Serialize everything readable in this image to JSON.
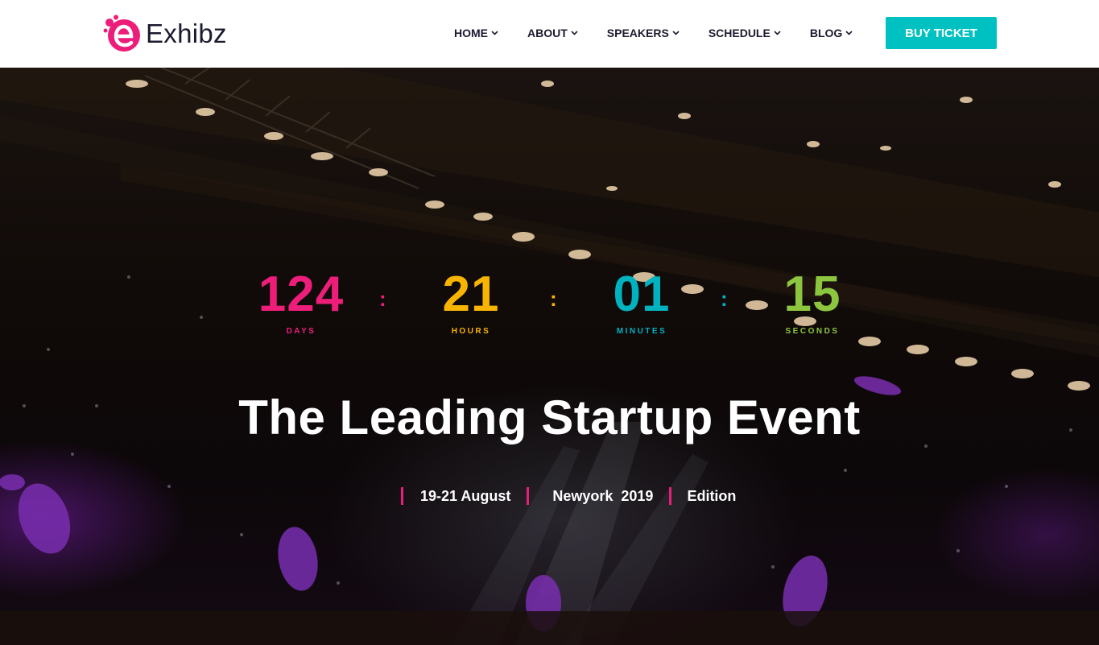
{
  "brand": {
    "name": "Exhibz",
    "logo_letter": "e"
  },
  "nav": {
    "items": [
      {
        "label": "HOME"
      },
      {
        "label": "ABOUT"
      },
      {
        "label": "SPEAKERS"
      },
      {
        "label": "SCHEDULE"
      },
      {
        "label": "BLOG"
      }
    ],
    "cta_label": "BUY TICKET"
  },
  "countdown": {
    "separator": ":",
    "units": [
      {
        "value": "124",
        "label": "DAYS",
        "color": "#ec1e79"
      },
      {
        "value": "21",
        "label": "HOURS",
        "color": "#f7b400"
      },
      {
        "value": "01",
        "label": "MINUTES",
        "color": "#00b2c0"
      },
      {
        "value": "15",
        "label": "SECONDS",
        "color": "#8cc63f"
      }
    ]
  },
  "hero": {
    "title": "The Leading Startup Event",
    "meta": [
      "19-21 August",
      "Newyork  2019",
      "Edition"
    ]
  },
  "colors": {
    "accent_cyan": "#00c1c1",
    "accent_pink": "#e91e7a",
    "header_bg": "#ffffff",
    "nav_text": "#1b1b2f"
  }
}
